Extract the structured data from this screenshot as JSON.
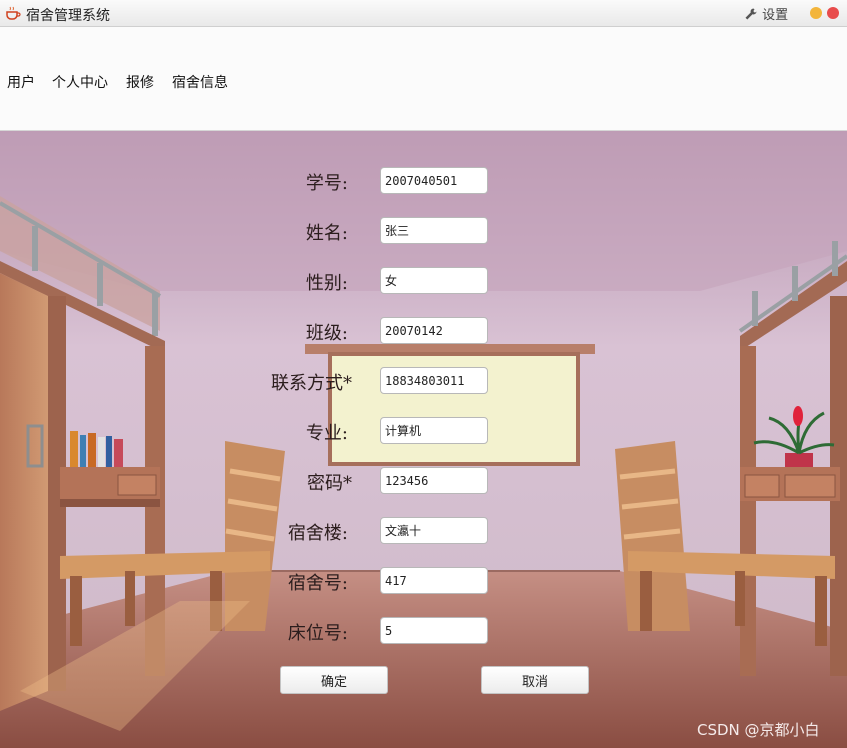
{
  "window": {
    "title": "宿舍管理系统",
    "settings_label": "设置"
  },
  "menu": {
    "items": [
      "用户",
      "个人中心",
      "报修",
      "宿舍信息"
    ]
  },
  "form": {
    "fields": [
      {
        "label": "学号:",
        "value": "2007040501"
      },
      {
        "label": "姓名:",
        "value": "张三"
      },
      {
        "label": "性别:",
        "value": "女"
      },
      {
        "label": "班级:",
        "value": "20070142"
      },
      {
        "label": "联系方式*",
        "value": "18834803011"
      },
      {
        "label": "专业:",
        "value": "计算机"
      },
      {
        "label": "密码*",
        "value": "123456"
      },
      {
        "label": "宿舍楼:",
        "value": "文瀛十"
      },
      {
        "label": "宿舍号:",
        "value": "417"
      },
      {
        "label": "床位号:",
        "value": "5"
      }
    ],
    "confirm_label": "确定",
    "cancel_label": "取消"
  },
  "watermark": "CSDN @京都小白",
  "colors": {
    "accent_close": "#e84c4c",
    "accent_minimize": "#f3b53b",
    "scene_wall": "#cdb2c6",
    "scene_floor": "#a8695a"
  }
}
